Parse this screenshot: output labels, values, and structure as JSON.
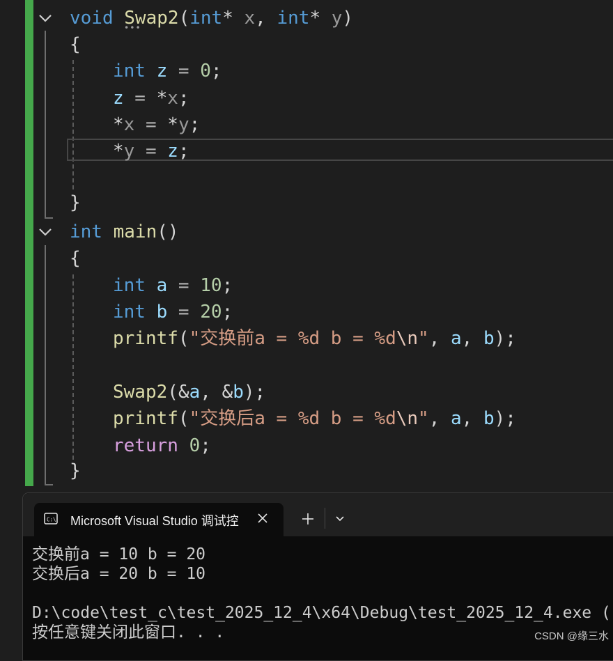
{
  "editor": {
    "lines": [
      {
        "id": "swap2-signature",
        "tokens": [
          {
            "t": "void",
            "c": "kw"
          },
          {
            "t": " ",
            "c": "pun"
          },
          {
            "t": "Swap2",
            "c": "fn"
          },
          {
            "t": "(",
            "c": "pun"
          },
          {
            "t": "int",
            "c": "kw"
          },
          {
            "t": "* ",
            "c": "pun"
          },
          {
            "t": "x",
            "c": "prm"
          },
          {
            "t": ", ",
            "c": "pun"
          },
          {
            "t": "int",
            "c": "kw"
          },
          {
            "t": "* ",
            "c": "pun"
          },
          {
            "t": "y",
            "c": "prm"
          },
          {
            "t": ")",
            "c": "pun"
          }
        ]
      },
      {
        "id": "open-brace-1",
        "tokens": [
          {
            "t": "{",
            "c": "pun"
          }
        ]
      },
      {
        "id": "line-int-z",
        "tokens": [
          {
            "t": "int",
            "c": "kw"
          },
          {
            "t": " ",
            "c": "pun"
          },
          {
            "t": "z",
            "c": "var"
          },
          {
            "t": " = ",
            "c": "op"
          },
          {
            "t": "0",
            "c": "num"
          },
          {
            "t": ";",
            "c": "pun"
          }
        ]
      },
      {
        "id": "line-z-assign",
        "tokens": [
          {
            "t": "z",
            "c": "var"
          },
          {
            "t": " = ",
            "c": "op"
          },
          {
            "t": "*",
            "c": "pun"
          },
          {
            "t": "x",
            "c": "prm"
          },
          {
            "t": ";",
            "c": "pun"
          }
        ]
      },
      {
        "id": "line-x-assign",
        "tokens": [
          {
            "t": "*",
            "c": "pun"
          },
          {
            "t": "x",
            "c": "prm"
          },
          {
            "t": " = ",
            "c": "op"
          },
          {
            "t": "*",
            "c": "pun"
          },
          {
            "t": "y",
            "c": "prm"
          },
          {
            "t": ";",
            "c": "pun"
          }
        ]
      },
      {
        "id": "line-y-assign",
        "tokens": [
          {
            "t": "*",
            "c": "pun"
          },
          {
            "t": "y",
            "c": "prm"
          },
          {
            "t": " = ",
            "c": "op"
          },
          {
            "t": "z",
            "c": "var"
          },
          {
            "t": ";",
            "c": "pun"
          }
        ]
      },
      {
        "id": "close-brace-1",
        "tokens": [
          {
            "t": "}",
            "c": "pun"
          }
        ]
      },
      {
        "id": "main-signature",
        "tokens": [
          {
            "t": "int",
            "c": "kw"
          },
          {
            "t": " ",
            "c": "pun"
          },
          {
            "t": "main",
            "c": "fn"
          },
          {
            "t": "()",
            "c": "pun"
          }
        ]
      },
      {
        "id": "open-brace-2",
        "tokens": [
          {
            "t": "{",
            "c": "pun"
          }
        ]
      },
      {
        "id": "line-int-a",
        "tokens": [
          {
            "t": "int",
            "c": "kw"
          },
          {
            "t": " ",
            "c": "pun"
          },
          {
            "t": "a",
            "c": "var"
          },
          {
            "t": " = ",
            "c": "op"
          },
          {
            "t": "10",
            "c": "num"
          },
          {
            "t": ";",
            "c": "pun"
          }
        ]
      },
      {
        "id": "line-int-b",
        "tokens": [
          {
            "t": "int",
            "c": "kw"
          },
          {
            "t": " ",
            "c": "pun"
          },
          {
            "t": "b",
            "c": "var"
          },
          {
            "t": " = ",
            "c": "op"
          },
          {
            "t": "20",
            "c": "num"
          },
          {
            "t": ";",
            "c": "pun"
          }
        ]
      },
      {
        "id": "line-printf-before",
        "tokens": [
          {
            "t": "printf",
            "c": "fn"
          },
          {
            "t": "(",
            "c": "pun"
          },
          {
            "t": "\"交换前a = %d b = %d",
            "c": "str"
          },
          {
            "t": "\\n",
            "c": "esc"
          },
          {
            "t": "\"",
            "c": "str"
          },
          {
            "t": ", ",
            "c": "pun"
          },
          {
            "t": "a",
            "c": "var"
          },
          {
            "t": ", ",
            "c": "pun"
          },
          {
            "t": "b",
            "c": "var"
          },
          {
            "t": ");",
            "c": "pun"
          }
        ]
      },
      {
        "id": "line-swap-call",
        "tokens": [
          {
            "t": "Swap2",
            "c": "fn"
          },
          {
            "t": "(",
            "c": "pun"
          },
          {
            "t": "&",
            "c": "pun"
          },
          {
            "t": "a",
            "c": "var"
          },
          {
            "t": ", ",
            "c": "pun"
          },
          {
            "t": "&",
            "c": "pun"
          },
          {
            "t": "b",
            "c": "var"
          },
          {
            "t": ");",
            "c": "pun"
          }
        ]
      },
      {
        "id": "line-printf-after",
        "tokens": [
          {
            "t": "printf",
            "c": "fn"
          },
          {
            "t": "(",
            "c": "pun"
          },
          {
            "t": "\"交换后a = %d b = %d",
            "c": "str"
          },
          {
            "t": "\\n",
            "c": "esc"
          },
          {
            "t": "\"",
            "c": "str"
          },
          {
            "t": ", ",
            "c": "pun"
          },
          {
            "t": "a",
            "c": "var"
          },
          {
            "t": ", ",
            "c": "pun"
          },
          {
            "t": "b",
            "c": "var"
          },
          {
            "t": ");",
            "c": "pun"
          }
        ]
      },
      {
        "id": "line-return",
        "tokens": [
          {
            "t": "return",
            "c": "ctl"
          },
          {
            "t": " ",
            "c": "pun"
          },
          {
            "t": "0",
            "c": "num"
          },
          {
            "t": ";",
            "c": "pun"
          }
        ]
      },
      {
        "id": "close-brace-2",
        "tokens": [
          {
            "t": "}",
            "c": "pun"
          }
        ]
      }
    ],
    "colors": {
      "keyword": "#569cd6",
      "function": "#dcdcaa",
      "variable": "#9cdcfe",
      "string": "#d69d85",
      "number": "#b5cea8",
      "control": "#d8a0df",
      "change_marker": "#45a84b"
    }
  },
  "console": {
    "tab_title": "Microsoft Visual Studio 调试控",
    "tab_icon": "terminal-icon",
    "output": {
      "line1": "交换前a = 10 b = 20",
      "line2": "交换后a = 20 b = 10",
      "line3": "",
      "line4": "D:\\code\\test_c\\test_2025_12_4\\x64\\Debug\\test_2025_12_4.exe (",
      "line5": "按任意键关闭此窗口. . ."
    }
  },
  "watermark": "CSDN @缘三水"
}
